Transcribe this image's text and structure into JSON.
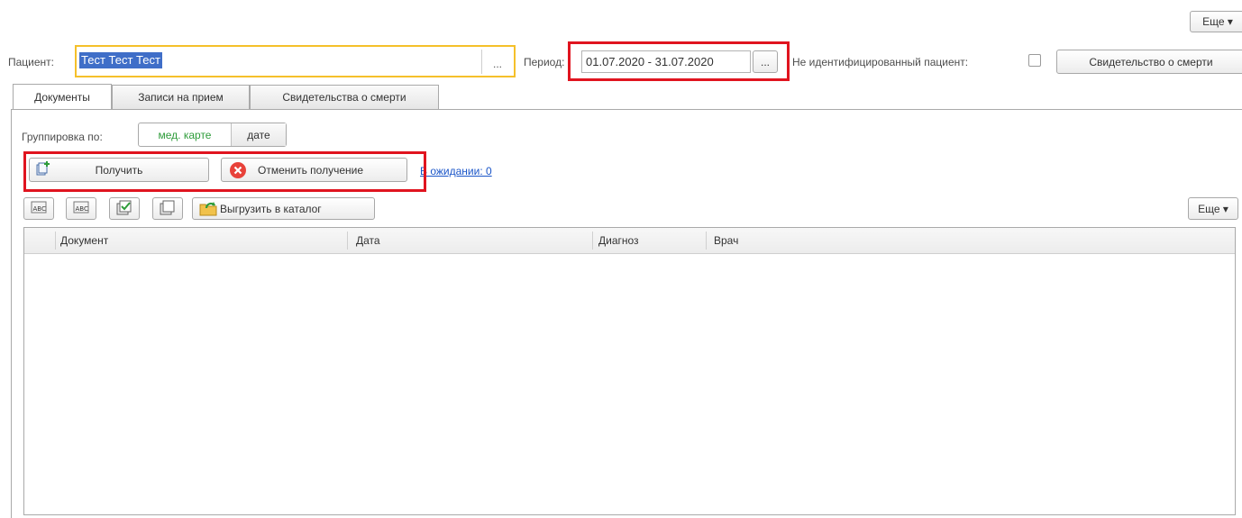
{
  "toolbar_top": {
    "more_label": "Еще ▾"
  },
  "patient": {
    "label": "Пациент:",
    "value": "Тест Тест Тест",
    "choose_label": "..."
  },
  "period": {
    "label": "Период:",
    "value": "01.07.2020 - 31.07.2020",
    "choose_label": "..."
  },
  "unidentified": {
    "label": "Не идентифицированный пациент:",
    "checked": false
  },
  "death_cert_button": "Свидетельство о смерти",
  "tabs": [
    {
      "label": "Документы",
      "active": true
    },
    {
      "label": "Записи на прием",
      "active": false
    },
    {
      "label": "Свидетельства о смерти",
      "active": false
    }
  ],
  "grouping": {
    "label": "Группировка по:",
    "options": [
      {
        "label": "мед. карте",
        "selected": true
      },
      {
        "label": "дате",
        "selected": false
      }
    ]
  },
  "actions": {
    "get_label": "Получить",
    "cancel_label": "Отменить получение",
    "pending_link": "В ожидании: 0"
  },
  "table_toolbar": {
    "export_label": "Выгрузить в каталог",
    "more_label": "Еще ▾"
  },
  "table": {
    "columns": [
      "Документ",
      "Дата",
      "Диагноз",
      "Врач"
    ],
    "rows": []
  },
  "colors": {
    "highlight_red": "#e0141f",
    "highlight_yellow": "#f5c02a",
    "selection_blue": "#3f6ec8",
    "selected_option_green": "#2e9c3a",
    "link_blue": "#1a55c8"
  }
}
